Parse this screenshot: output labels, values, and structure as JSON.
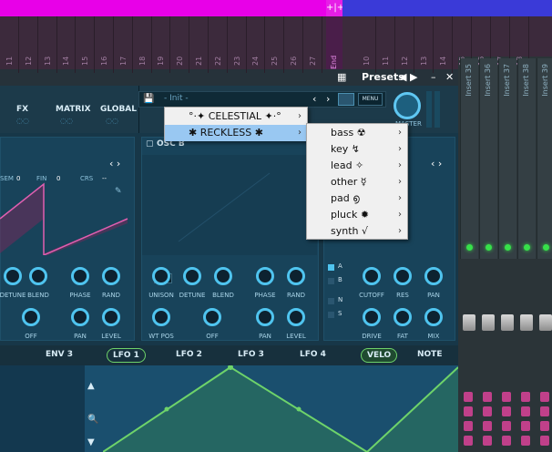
{
  "window": {
    "title": "Presets",
    "arrows": "◀ ▶",
    "minimize": "–",
    "close": "✕",
    "grid_icon": "grid-icon"
  },
  "playlist": {
    "marker_glyph": "+|+",
    "end_label": "End",
    "numbers": [
      "11",
      "12",
      "13",
      "14",
      "15",
      "16",
      "17",
      "18",
      "19",
      "20",
      "21",
      "22",
      "23",
      "24",
      "25",
      "26",
      "27"
    ],
    "right_numbers": [
      "10",
      "11",
      "12",
      "13",
      "14",
      "15",
      "16",
      "17",
      "18"
    ]
  },
  "mixer": {
    "inserts": [
      "Insert 35",
      "Insert 36",
      "Insert 37",
      "Insert 38",
      "Insert 39"
    ]
  },
  "synth": {
    "tabs": [
      "FX",
      "MATRIX",
      "GLOBAL"
    ],
    "preset_name": "- Init -",
    "menu_label": "MENU",
    "master_label": "MASTER",
    "osc_b": "OSC B",
    "osc_a_readouts": {
      "sem": "SEM",
      "sem_val": "0",
      "fin": "FIN",
      "fin_val": "0",
      "crs": "CRS",
      "crs_val": "--"
    },
    "knobs_a_row1": [
      "DETUNE",
      "BLEND",
      "PHASE",
      "RAND"
    ],
    "knobs_a_row2": [
      "OFF",
      "PAN",
      "LEVEL"
    ],
    "knobs_b_row1": [
      "UNISON",
      "DETUNE",
      "BLEND",
      "PHASE",
      "RAND"
    ],
    "knobs_b_row2": [
      "WT POS",
      "OFF",
      "PAN",
      "LEVEL"
    ],
    "unison_value": "1",
    "filter_knobs_row1": [
      "CUTOFF",
      "RES",
      "PAN"
    ],
    "filter_knobs_row2": [
      "DRIVE",
      "FAT",
      "MIX"
    ],
    "routes": [
      "A",
      "B",
      "N",
      "S"
    ],
    "mod_tabs": [
      "ENV 3",
      "LFO 1",
      "LFO 2",
      "LFO 3",
      "LFO 4",
      "VELO",
      "NOTE"
    ]
  },
  "menu1": {
    "items": [
      {
        "label": "°·✦ CELESTIAL ✦·°",
        "arrow": "›",
        "selected": false
      },
      {
        "label": "✱ RECKLESS ✱",
        "arrow": "›",
        "selected": true
      }
    ]
  },
  "menu2": {
    "items": [
      {
        "label": "bass ☢",
        "arrow": "›"
      },
      {
        "label": "key ↯",
        "arrow": "›"
      },
      {
        "label": "lead ✧",
        "arrow": "›"
      },
      {
        "label": "other ☿",
        "arrow": "›"
      },
      {
        "label": "pad ൭",
        "arrow": "›"
      },
      {
        "label": "pluck ✹",
        "arrow": "›"
      },
      {
        "label": "synth √",
        "arrow": "›"
      }
    ]
  },
  "colors": {
    "accent": "#4fc4ef",
    "magenta": "#e800e8",
    "menu_highlight": "#99c8f2",
    "lfo_green": "#6ed36a"
  }
}
